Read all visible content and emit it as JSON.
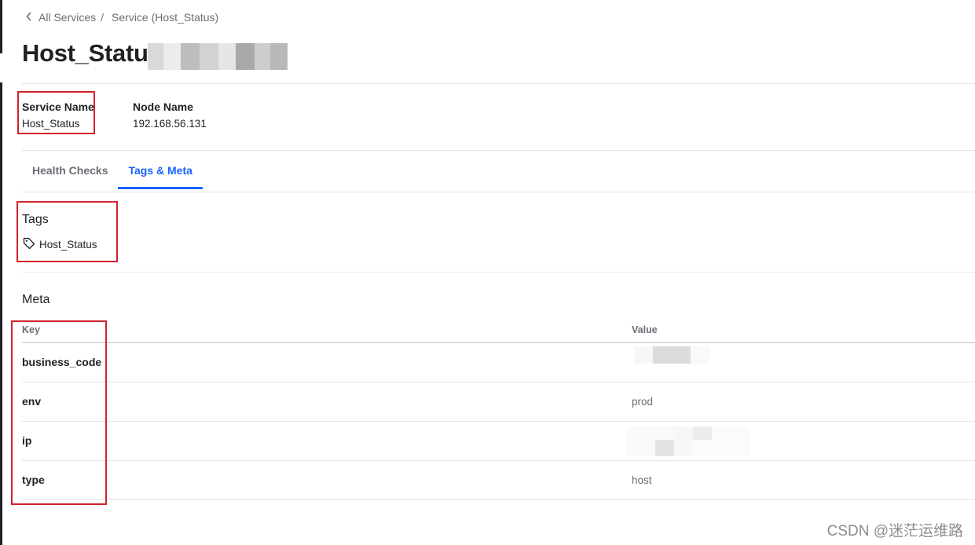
{
  "breadcrumb": {
    "back_label": "All Services",
    "separator": "/",
    "current": "Service (Host_Status)"
  },
  "page": {
    "title": "Host_Status"
  },
  "service_info": {
    "service_name_label": "Service Name",
    "service_name_value": "Host_Status",
    "node_name_label": "Node Name",
    "node_name_value": "192.168.56.131"
  },
  "tabs": [
    {
      "label": "Health Checks",
      "active": false
    },
    {
      "label": "Tags & Meta",
      "active": true
    }
  ],
  "tags": {
    "heading": "Tags",
    "items": [
      "Host_Status"
    ],
    "icon": "tag-icon"
  },
  "meta": {
    "heading": "Meta",
    "columns": {
      "key": "Key",
      "value": "Value"
    },
    "rows": [
      {
        "key": "business_code",
        "value": ""
      },
      {
        "key": "env",
        "value": "prod"
      },
      {
        "key": "ip",
        "value": ""
      },
      {
        "key": "type",
        "value": "host"
      }
    ]
  },
  "colors": {
    "accent": "#1563ff",
    "annotation_red": "#d0232b",
    "text": "#1f2124",
    "muted": "#6a6d73"
  },
  "watermark": "CSDN @迷茫运维路"
}
